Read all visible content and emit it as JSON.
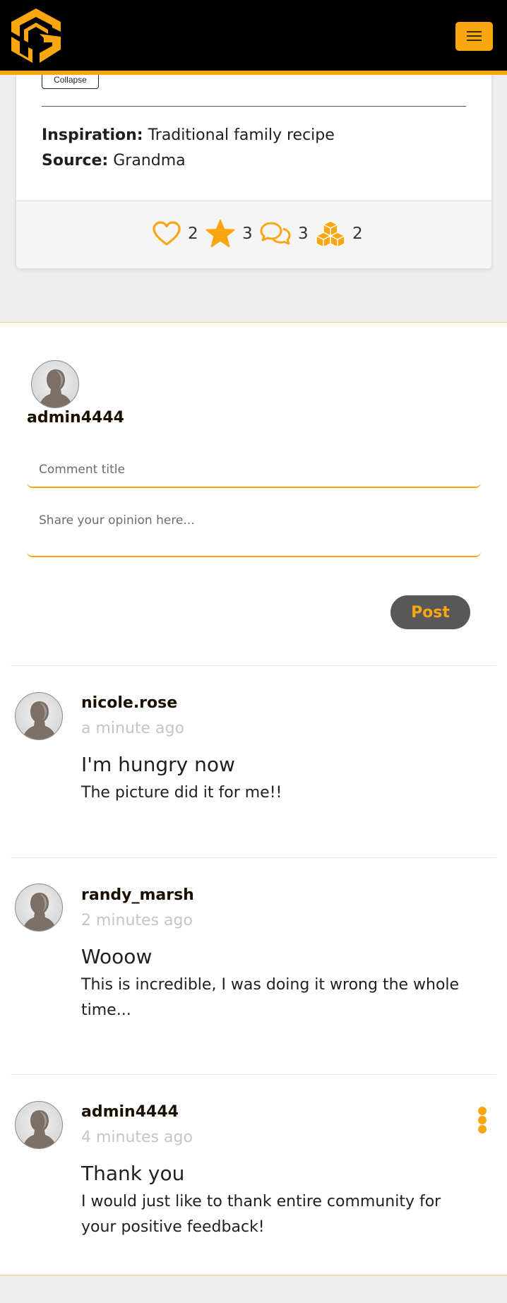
{
  "brand": {
    "accent": "#f9a611",
    "navbar_bg": "#000000"
  },
  "navbar": {
    "logo_icon": "cube-logo-icon",
    "menu_icon": "hamburger-icon"
  },
  "recipe": {
    "collapse_label": "Collapse",
    "inspiration_label": "Inspiration:",
    "inspiration_value": "Traditional family recipe",
    "source_label": "Source:",
    "source_value": "Grandma",
    "stats": {
      "likes": "2",
      "favorites": "3",
      "comments": "3",
      "shares": "2"
    }
  },
  "composer": {
    "username": "admin4444",
    "title_placeholder": "Comment title",
    "body_placeholder": "Share your opinion here...",
    "post_label": "Post"
  },
  "comments": [
    {
      "user": "nicole.rose",
      "time": "a minute ago",
      "title": "I'm hungry now",
      "text": "The picture did it for me!!"
    },
    {
      "user": "randy_marsh",
      "time": "2 minutes ago",
      "title": "Wooow",
      "text": "This is incredible, I was doing it wrong the whole time..."
    },
    {
      "user": "admin4444",
      "time": "4 minutes ago",
      "title": "Thank you",
      "text": "I would just like to thank entire community for your positive feedback!"
    }
  ]
}
